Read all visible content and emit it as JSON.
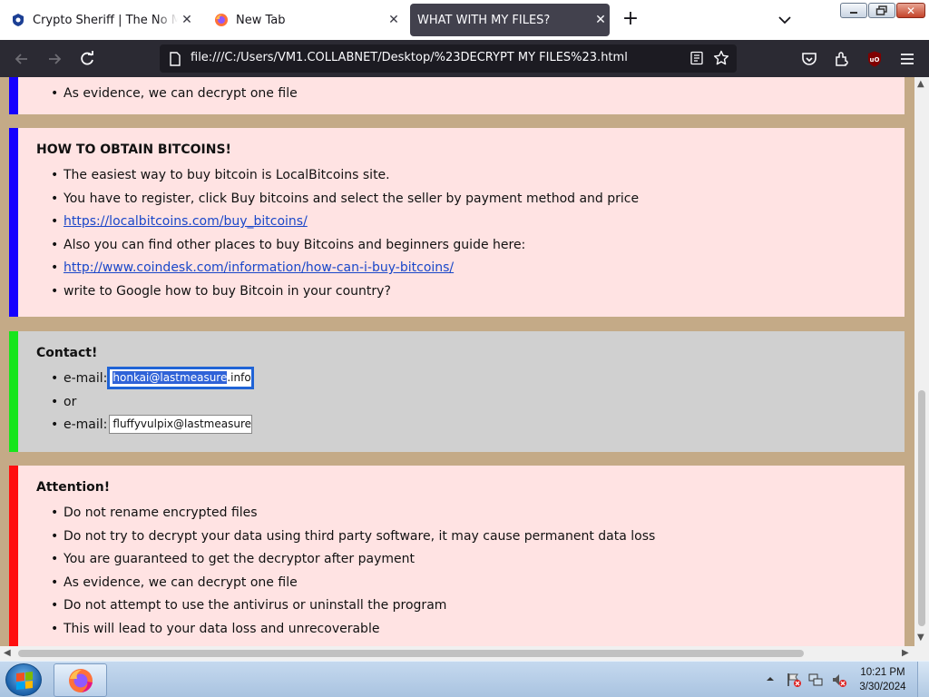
{
  "browser": {
    "tabs": [
      {
        "title": "Crypto Sheriff | The No More Ransom"
      },
      {
        "title": "New Tab"
      },
      {
        "title": "WHAT WITH MY FILES?",
        "active": true
      }
    ],
    "url": "file:///C:/Users/VM1.COLLABNET/Desktop/%23DECRYPT MY FILES%23.html",
    "accent_color": "#42414d"
  },
  "page": {
    "top_box": {
      "items": [
        "As evidence, we can decrypt one file"
      ]
    },
    "obtain": {
      "title": "HOW TO OBTAIN BITCOINS!",
      "item1": "The easiest way to buy bitcoin is LocalBitcoins site.",
      "item2": "You have to register, click Buy bitcoins and select the seller by payment method and price",
      "link1": "https://localbitcoins.com/buy_bitcoins/",
      "item4": "Also you can find other places to buy Bitcoins and beginners guide here:",
      "link2": "http://www.coindesk.com/information/how-can-i-buy-bitcoins/",
      "item6": "write to Google how to buy Bitcoin in your country?"
    },
    "contact": {
      "title": "Contact!",
      "email_label": "e-mail:",
      "email1_selected": "honkai@lastmeasure",
      "email1_rest": ".info",
      "or_text": "or",
      "email2": "fluffyvulpix@lastmeasure.i"
    },
    "attention": {
      "title": "Attention!",
      "items": [
        "Do not rename encrypted files",
        "Do not try to decrypt your data using third party software, it may cause permanent data loss",
        "You are guaranteed to get the decryptor after payment",
        "As evidence, we can decrypt one file",
        "Do not attempt to use the antivirus or uninstall the program",
        "This will lead to your data loss and unrecoverable"
      ]
    },
    "colors": {
      "blue_bar": "#1400ff",
      "green_bar": "#17e51c",
      "red_bar": "#ff0f0f",
      "box_bg": "#ffe3e3",
      "page_bg": "#c4aa87"
    }
  },
  "taskbar": {
    "clock_time": "10:21 PM",
    "clock_date": "3/30/2024",
    "tray_icons": [
      "show-hidden-icons-arrow",
      "action-center-flag-icon",
      "network-icon",
      "volume-muted-icon"
    ]
  }
}
